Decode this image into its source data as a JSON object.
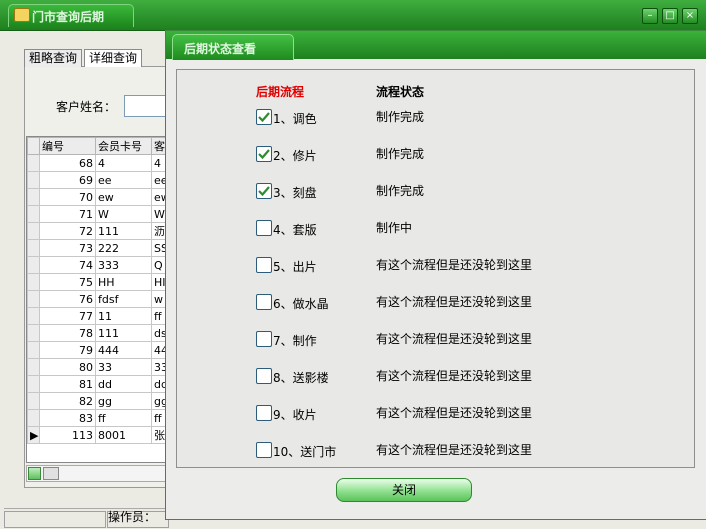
{
  "main_window": {
    "title": "门市查询后期"
  },
  "tabs": [
    {
      "label": "粗略查询"
    },
    {
      "label": "详细查询"
    }
  ],
  "customer_label": "客户姓名：",
  "grid": {
    "headers": [
      "编号",
      "会员卡号",
      "客"
    ],
    "rows": [
      {
        "id": "68",
        "card": "4",
        "c": "4"
      },
      {
        "id": "69",
        "card": "ee",
        "c": "ee"
      },
      {
        "id": "70",
        "card": "ew",
        "c": "ew"
      },
      {
        "id": "71",
        "card": "W",
        "c": "W"
      },
      {
        "id": "72",
        "card": "111",
        "c": "沥"
      },
      {
        "id": "73",
        "card": "222",
        "c": "SS"
      },
      {
        "id": "74",
        "card": "333",
        "c": "Q"
      },
      {
        "id": "75",
        "card": "HH",
        "c": "HI"
      },
      {
        "id": "76",
        "card": "fdsf",
        "c": "w"
      },
      {
        "id": "77",
        "card": "11",
        "c": "ff"
      },
      {
        "id": "78",
        "card": "111",
        "c": "ds"
      },
      {
        "id": "79",
        "card": "444",
        "c": "44"
      },
      {
        "id": "80",
        "card": "33",
        "c": "33"
      },
      {
        "id": "81",
        "card": "dd",
        "c": "dd"
      },
      {
        "id": "82",
        "card": "gg",
        "c": "gg"
      },
      {
        "id": "83",
        "card": "ff",
        "c": "ff"
      },
      {
        "id": "113",
        "card": "8001",
        "c": "张"
      }
    ]
  },
  "status_bar": {
    "operator": "操作员："
  },
  "dialog": {
    "title": "后期状态查看",
    "col_process": "后期流程",
    "col_status": "流程状态",
    "steps": [
      {
        "label": "1、调色",
        "status": "制作完成",
        "checked": true
      },
      {
        "label": "2、修片",
        "status": "制作完成",
        "checked": true
      },
      {
        "label": "3、刻盘",
        "status": "制作完成",
        "checked": true
      },
      {
        "label": "4、套版",
        "status": "制作中",
        "checked": false
      },
      {
        "label": "5、出片",
        "status": "有这个流程但是还没轮到这里",
        "checked": false
      },
      {
        "label": "6、做水晶",
        "status": "有这个流程但是还没轮到这里",
        "checked": false
      },
      {
        "label": "7、制作",
        "status": "有这个流程但是还没轮到这里",
        "checked": false
      },
      {
        "label": "8、送影楼",
        "status": "有这个流程但是还没轮到这里",
        "checked": false
      },
      {
        "label": "9、收片",
        "status": "有这个流程但是还没轮到这里",
        "checked": false
      },
      {
        "label": "10、送门市",
        "status": "有这个流程但是还没轮到这里",
        "checked": false
      }
    ],
    "close_label": "关闭"
  },
  "colors": {
    "title_green": "#1e801e",
    "process_header": "#e00000",
    "check_green": "#2e8b2e"
  }
}
